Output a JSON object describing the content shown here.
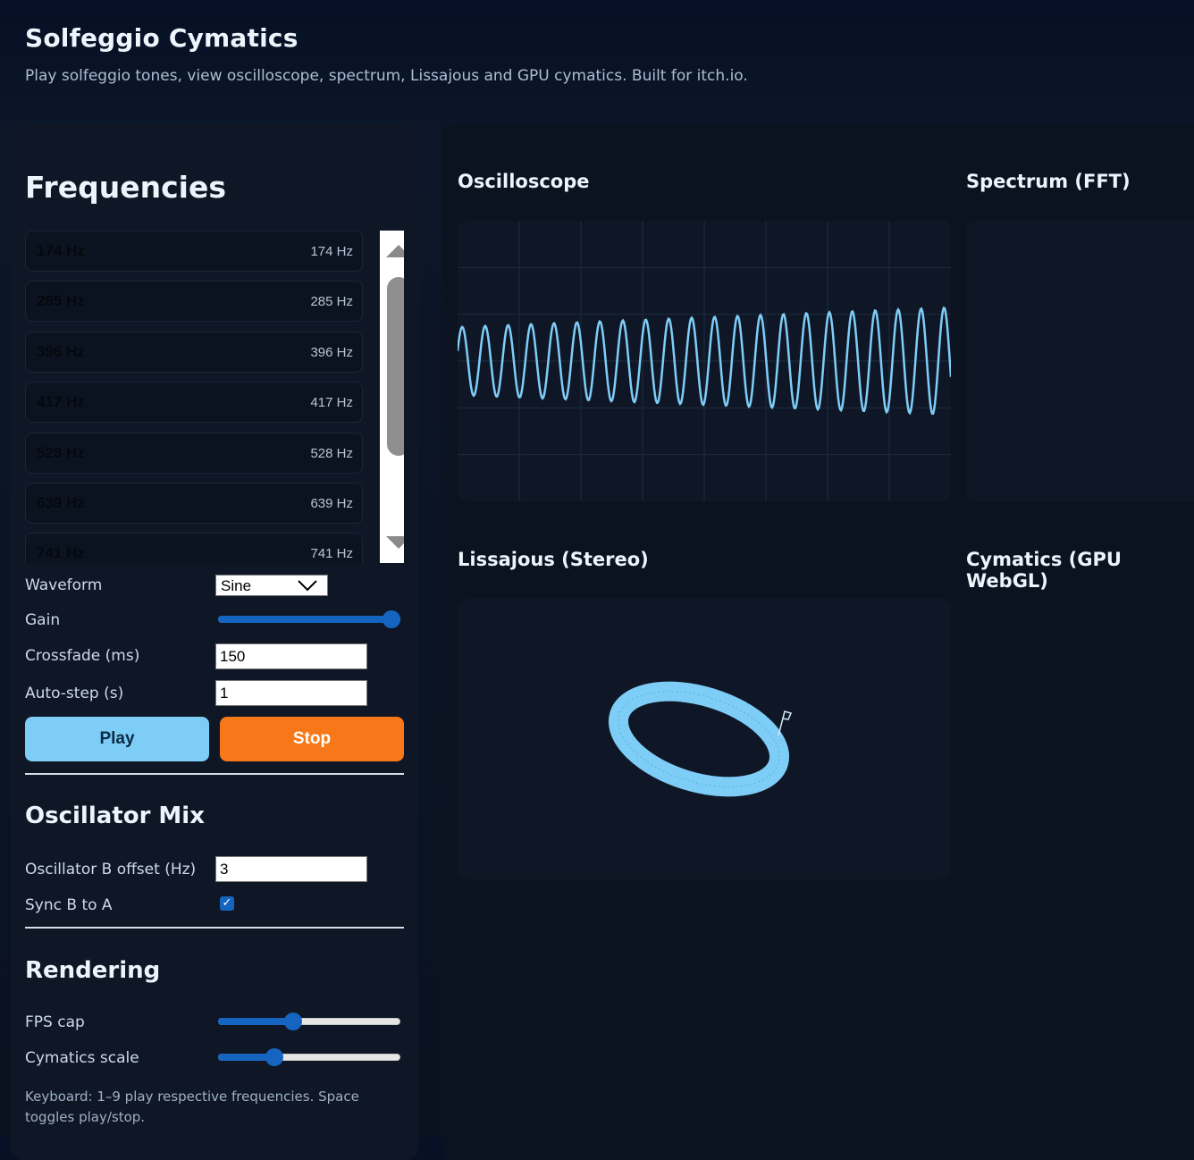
{
  "app": {
    "title": "Solfeggio Cymatics",
    "subtitle": "Play solfeggio tones, view oscilloscope, spectrum, Lissajous and GPU cymatics. Built for itch.io."
  },
  "frequencies": {
    "title": "Frequencies",
    "items": [
      {
        "name": "174 Hz",
        "value": "174 Hz"
      },
      {
        "name": "285 Hz",
        "value": "285 Hz"
      },
      {
        "name": "396 Hz",
        "value": "396 Hz"
      },
      {
        "name": "417 Hz",
        "value": "417 Hz"
      },
      {
        "name": "528 Hz",
        "value": "528 Hz"
      },
      {
        "name": "639 Hz",
        "value": "639 Hz"
      },
      {
        "name": "741 Hz",
        "value": "741 Hz"
      }
    ]
  },
  "controls": {
    "waveform_label": "Waveform",
    "waveform_value": "Sine",
    "gain_label": "Gain",
    "gain_value": 0.95,
    "crossfade_label": "Crossfade (ms)",
    "crossfade_value": "150",
    "autostep_label": "Auto-step (s)",
    "autostep_value": "1",
    "play_label": "Play",
    "stop_label": "Stop"
  },
  "oscillator_mix": {
    "title": "Oscillator Mix",
    "offset_label": "Oscillator B offset (Hz)",
    "offset_value": "3",
    "sync_label": "Sync B to A",
    "sync_checked": true
  },
  "rendering": {
    "title": "Rendering",
    "fps_label": "FPS cap",
    "fps_value": 0.41,
    "scale_label": "Cymatics scale",
    "scale_value": 0.31
  },
  "hint": "Keyboard: 1–9 play respective frequencies. Space toggles play/stop.",
  "visualizers": {
    "oscilloscope_title": "Oscilloscope",
    "spectrum_title": "Spectrum (FFT)",
    "lissajous_title": "Lissajous (Stereo)",
    "cymatics_title": "Cymatics (GPU WebGL)"
  },
  "colors": {
    "accent": "#7ecdf7",
    "stop": "#f77818",
    "trace": "#7ecdf7"
  }
}
